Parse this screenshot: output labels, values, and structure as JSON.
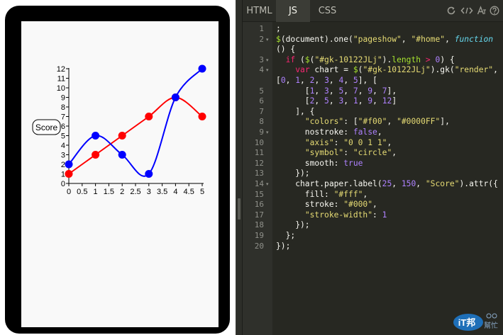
{
  "tabs": [
    {
      "label": "HTML",
      "active": false
    },
    {
      "label": "JS",
      "active": true
    },
    {
      "label": "CSS",
      "active": false
    }
  ],
  "toolbar_icons": [
    "refresh-icon",
    "embed-code-icon",
    "font-icon",
    "help-icon"
  ],
  "code_lines": [
    ";",
    "$(document).one(\"pageshow\", \"#home\", function",
    "() {",
    "  if ($(\"#gk-10122JLj\").length > 0) {",
    "    var chart = $(\"#gk-10122JLj\").gk(\"render\",",
    "[0, 1, 2, 3, 4, 5], [",
    "      [1, 3, 5, 7, 9, 7],",
    "      [2, 5, 3, 1, 9, 12]",
    "    ], {",
    "      \"colors\": [\"#f00\", \"#0000FF\"],",
    "      nostroke: false,",
    "      \"axis\": \"0 0 1 1\",",
    "      \"symbol\": \"circle\",",
    "      smooth: true",
    "    });",
    "    chart.paper.label(25, 150, \"Score\").attr({",
    "      fill: \"#fff\",",
    "      stroke: \"#000\",",
    "      \"stroke-width\": 1",
    "    });",
    "  };",
    "});"
  ],
  "line_numbers": [
    "1",
    "2",
    "3",
    "4",
    "5",
    "6",
    "7",
    "8",
    "9",
    "10",
    "11",
    "12",
    "13",
    "14",
    "15",
    "16",
    "17",
    "18",
    "19",
    "20"
  ],
  "chart_data": {
    "type": "line",
    "x": [
      0,
      1,
      2,
      3,
      4,
      5
    ],
    "series": [
      {
        "values": [
          1,
          3,
          5,
          7,
          9,
          7
        ],
        "color": "#ff0000"
      },
      {
        "values": [
          2,
          5,
          3,
          1,
          9,
          12
        ],
        "color": "#0000ff"
      }
    ],
    "xticks": [
      "0",
      "0.5",
      "1",
      "1.5",
      "2",
      "2.5",
      "3",
      "3.5",
      "4",
      "4.5",
      "5"
    ],
    "yticks": [
      "0",
      "1",
      "2",
      "3",
      "4",
      "5",
      "6",
      "7",
      "8",
      "9",
      "10",
      "11",
      "12"
    ],
    "xlim": [
      0,
      5
    ],
    "ylim": [
      0,
      12
    ],
    "smooth": true,
    "symbol": "circle",
    "label": "Score"
  },
  "watermark": {
    "brand": "iT邦",
    "sub": "幫忙"
  }
}
